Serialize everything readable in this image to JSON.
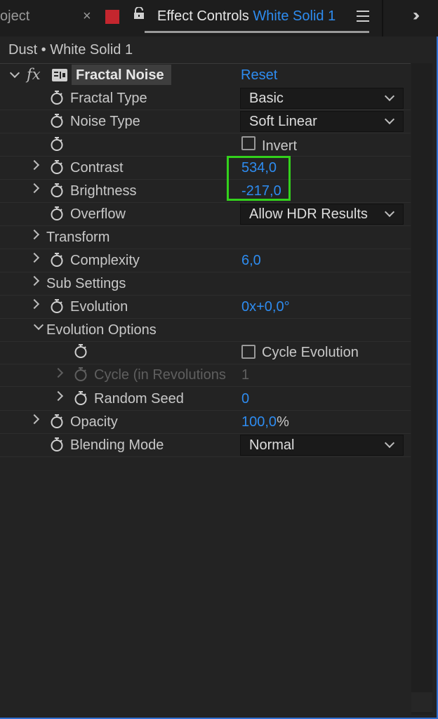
{
  "tab_bar": {
    "prev_tab_label": "oject",
    "active_tab_prefix": "Effect Controls",
    "active_tab_layer": "White Solid 1"
  },
  "breadcrumb": "Dust • White Solid 1",
  "effect": {
    "fx_label": "fx",
    "name": "Fractal Noise",
    "reset_label": "Reset"
  },
  "props": {
    "fractal_type": {
      "label": "Fractal Type",
      "value": "Basic"
    },
    "noise_type": {
      "label": "Noise Type",
      "value": "Soft Linear"
    },
    "invert": {
      "label": "Invert",
      "checked": false
    },
    "contrast": {
      "label": "Contrast",
      "value": "534,0"
    },
    "brightness": {
      "label": "Brightness",
      "value": "-217,0"
    },
    "overflow": {
      "label": "Overflow",
      "value": "Allow HDR Results"
    },
    "transform": {
      "label": "Transform"
    },
    "complexity": {
      "label": "Complexity",
      "value": "6,0"
    },
    "sub_settings": {
      "label": "Sub Settings"
    },
    "evolution": {
      "label": "Evolution",
      "value": "0x+0,0°"
    },
    "evolution_options": {
      "label": "Evolution Options"
    },
    "cycle_evolution": {
      "label": "Cycle Evolution",
      "checked": false
    },
    "cycle_revolutions": {
      "label": "Cycle (in Revolutions",
      "value": "1"
    },
    "random_seed": {
      "label": "Random Seed",
      "value": "0"
    },
    "opacity": {
      "label": "Opacity",
      "value": "100,0",
      "unit": "%"
    },
    "blending_mode": {
      "label": "Blending Mode",
      "value": "Normal"
    }
  },
  "colors": {
    "accent_blue": "#2e8cf0",
    "highlight_green": "#33d11c",
    "label_red": "#c4262e"
  }
}
